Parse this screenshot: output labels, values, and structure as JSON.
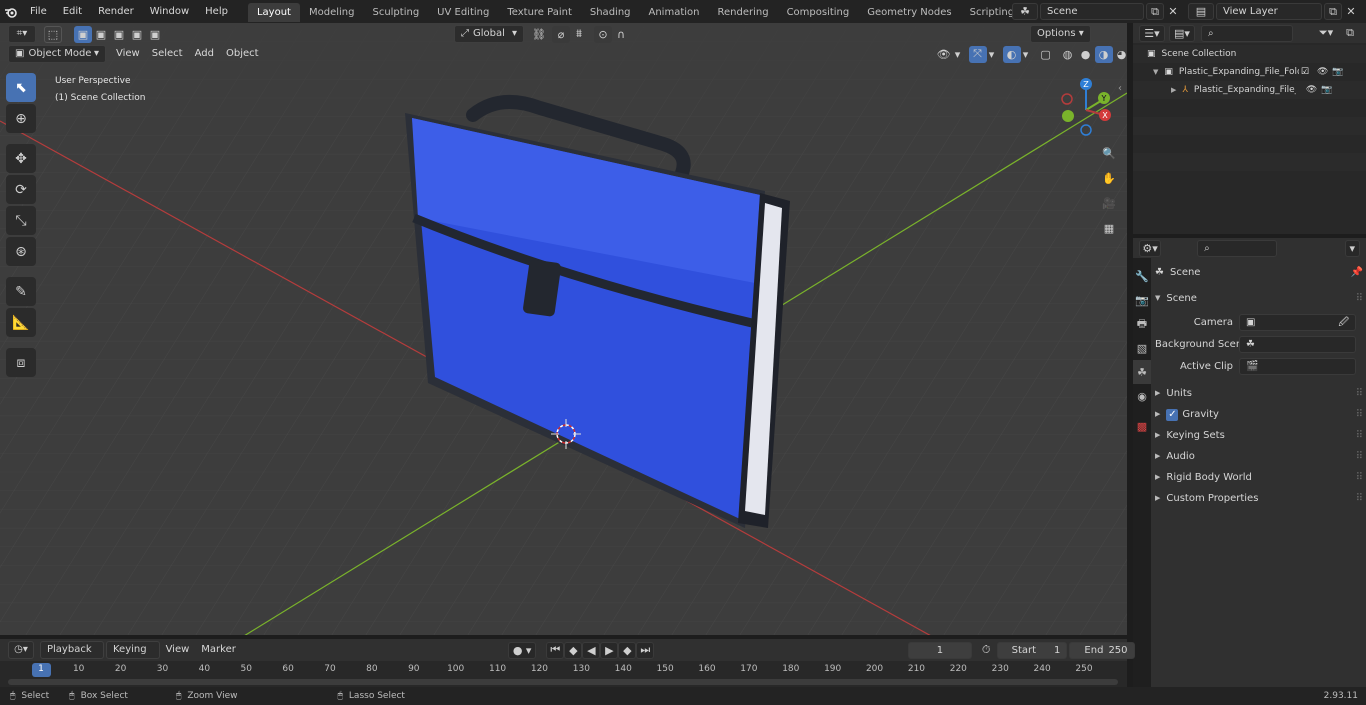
{
  "menu": {
    "items": [
      "File",
      "Edit",
      "Render",
      "Window",
      "Help"
    ]
  },
  "workspaces": [
    "Layout",
    "Modeling",
    "Sculpting",
    "UV Editing",
    "Texture Paint",
    "Shading",
    "Animation",
    "Rendering",
    "Compositing",
    "Geometry Nodes",
    "Scripting"
  ],
  "active_workspace": "Layout",
  "scene_field": "Scene",
  "view_layer_field": "View Layer",
  "viewport": {
    "mode": "Object Mode",
    "menus": [
      "View",
      "Select",
      "Add",
      "Object"
    ],
    "transform_orientation": "Global",
    "options_label": "Options",
    "overlay_line1": "User Perspective",
    "overlay_line2": "(1) Scene Collection",
    "gizmo": {
      "x": "X",
      "y": "Y",
      "z": "Z"
    }
  },
  "outliner": {
    "root": "Scene Collection",
    "collection": "Plastic_Expanding_File_Folder",
    "object": "Plastic_Expanding_File_Fo"
  },
  "properties": {
    "context": "Scene",
    "panel": "Scene",
    "fields": [
      {
        "label": "Camera"
      },
      {
        "label": "Background Scene"
      },
      {
        "label": "Active Clip"
      }
    ],
    "subpanels": [
      "Units",
      "Gravity",
      "Keying Sets",
      "Audio",
      "Rigid Body World",
      "Custom Properties"
    ]
  },
  "timeline": {
    "menus": [
      "Playback",
      "Keying",
      "View",
      "Marker"
    ],
    "current_frame": "1",
    "start_label": "Start",
    "start_value": "1",
    "end_label": "End",
    "end_value": "250",
    "ruler": [
      "1",
      "10",
      "20",
      "30",
      "40",
      "50",
      "60",
      "70",
      "80",
      "90",
      "100",
      "110",
      "120",
      "130",
      "140",
      "150",
      "160",
      "170",
      "180",
      "190",
      "200",
      "210",
      "220",
      "230",
      "240",
      "250"
    ]
  },
  "statusbar": {
    "items": [
      "Select",
      "Box Select",
      "Zoom View",
      "Lasso Select"
    ],
    "version": "2.93.11"
  },
  "colors": {
    "accent": "#4772b3",
    "folder_blue": "#3050dd",
    "axis_red": "#b43c3c",
    "axis_green": "#7ab32b",
    "gizmo_z": "#2f7fd6"
  }
}
